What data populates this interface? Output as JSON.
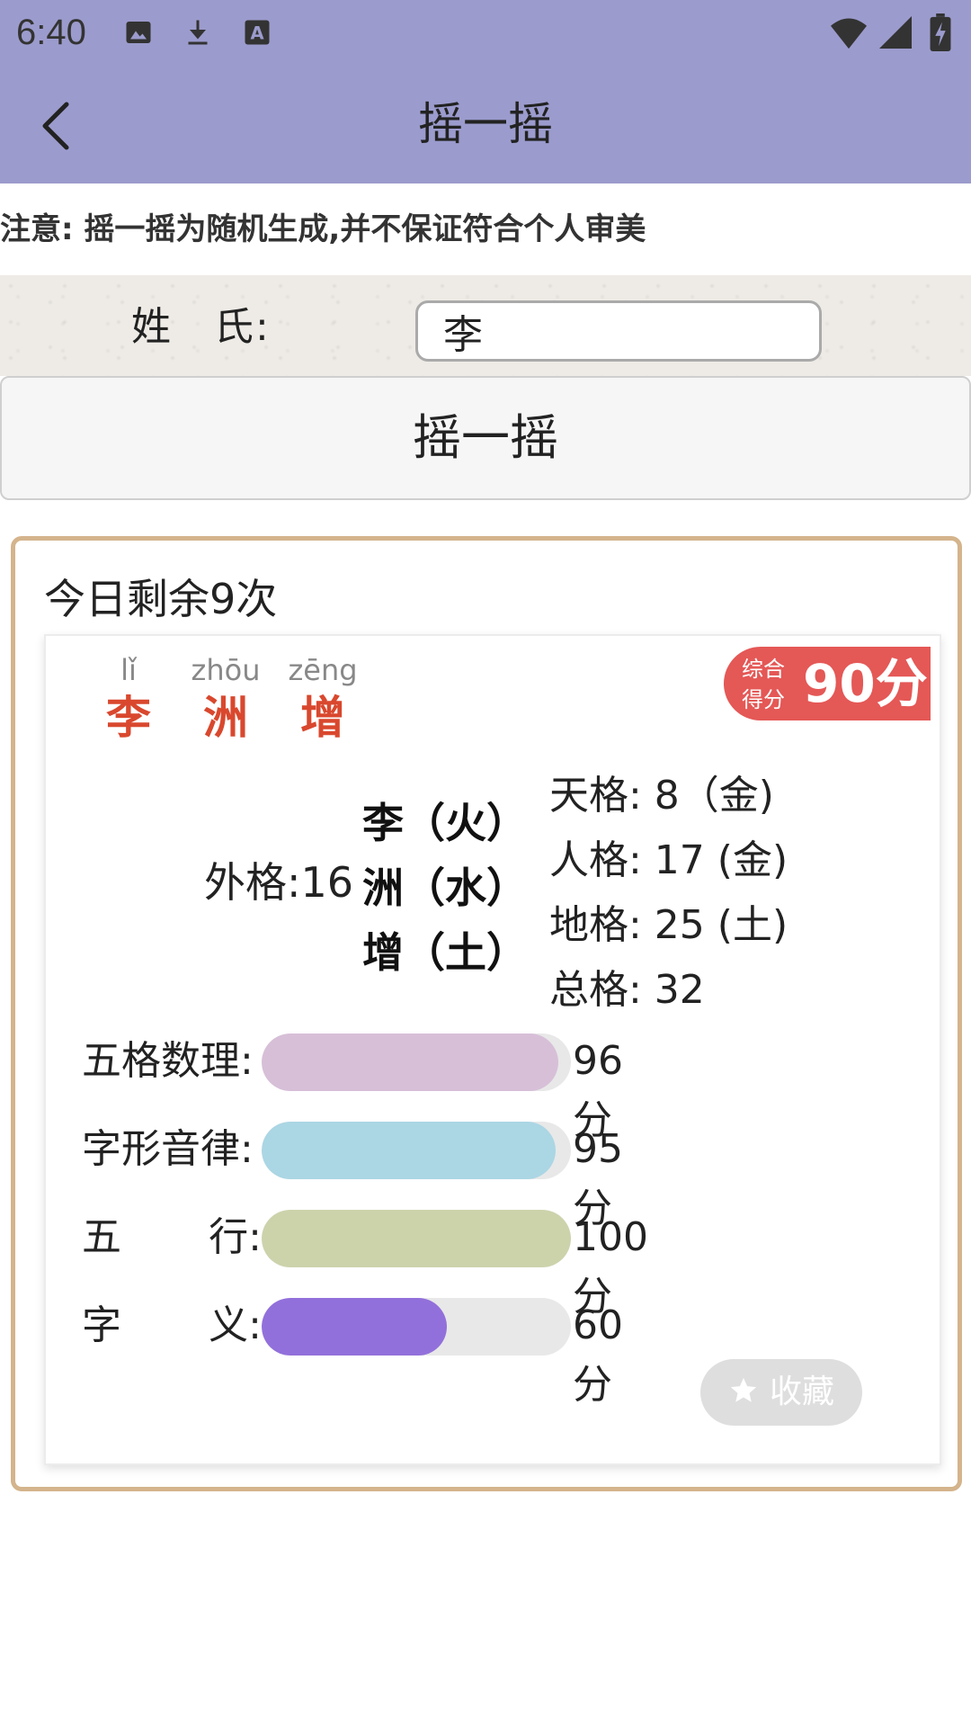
{
  "status_bar": {
    "time": "6:40",
    "icons": [
      "image-icon",
      "download-icon",
      "font-icon",
      "wifi-icon",
      "signal-icon",
      "battery-charging-icon"
    ]
  },
  "app_bar": {
    "title": "摇一摇",
    "back_icon": "chevron-left-icon",
    "color": "#9b9bcd"
  },
  "notice": "注意: 摇一摇为随机生成,并不保证符合个人审美",
  "surname": {
    "label": "姓　氏:",
    "value": "李"
  },
  "shake_button": "摇一摇",
  "result": {
    "remaining": "今日剩余9次",
    "name": [
      {
        "pinyin": "lǐ",
        "char": "李"
      },
      {
        "pinyin": "zhōu",
        "char": "洲"
      },
      {
        "pinyin": "zēng",
        "char": "增"
      }
    ],
    "score_caption": "综合得分",
    "score": "90分",
    "outer_grid": "外格:16",
    "elements": [
      "李（火）",
      "洲（水）",
      "增（土）"
    ],
    "grids": [
      "天格: 8（金)",
      "人格: 17 (金)",
      "地格: 25 (土)",
      "总格: 32"
    ],
    "bars": [
      {
        "label_left": "五格数理:",
        "label_right": "",
        "value": 96,
        "value_text": "96分",
        "color": "#d7bfd8"
      },
      {
        "label_left": "字形音律:",
        "label_right": "",
        "value": 95,
        "value_text": "95分",
        "color": "#abd6e4"
      },
      {
        "label_left": "五",
        "label_right": "行:",
        "value": 100,
        "value_text": "100分",
        "color": "#ccd3ab"
      },
      {
        "label_left": "字",
        "label_right": "义:",
        "value": 60,
        "value_text": "60分",
        "color": "#9270db"
      }
    ],
    "favorite_label": "收藏"
  }
}
